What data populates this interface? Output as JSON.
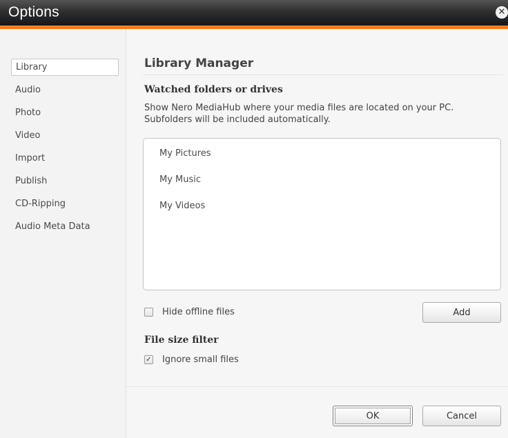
{
  "window": {
    "title": "Options",
    "close_icon": "close-icon"
  },
  "sidebar": {
    "items": [
      {
        "label": "Library",
        "active": true
      },
      {
        "label": "Audio",
        "active": false
      },
      {
        "label": "Photo",
        "active": false
      },
      {
        "label": "Video",
        "active": false
      },
      {
        "label": "Import",
        "active": false
      },
      {
        "label": "Publish",
        "active": false
      },
      {
        "label": "CD-Ripping",
        "active": false
      },
      {
        "label": "Audio Meta Data",
        "active": false
      }
    ]
  },
  "main": {
    "title": "Library Manager",
    "watched": {
      "heading": "Watched folders or drives",
      "description": "Show Nero MediaHub where your media files are located on your PC. Subfolders will be included automatically.",
      "folders": [
        "My Pictures",
        "My Music",
        "My Videos"
      ]
    },
    "hide_offline": {
      "label": "Hide offline files",
      "checked": false
    },
    "add_button": "Add",
    "file_size_filter": {
      "heading": "File size filter",
      "ignore_small": {
        "label": "Ignore small files",
        "checked": true,
        "mark": "✓"
      }
    }
  },
  "footer": {
    "ok": "OK",
    "cancel": "Cancel"
  },
  "colors": {
    "accent_orange": "#f36d10",
    "titlebar_dark": "#111111"
  }
}
